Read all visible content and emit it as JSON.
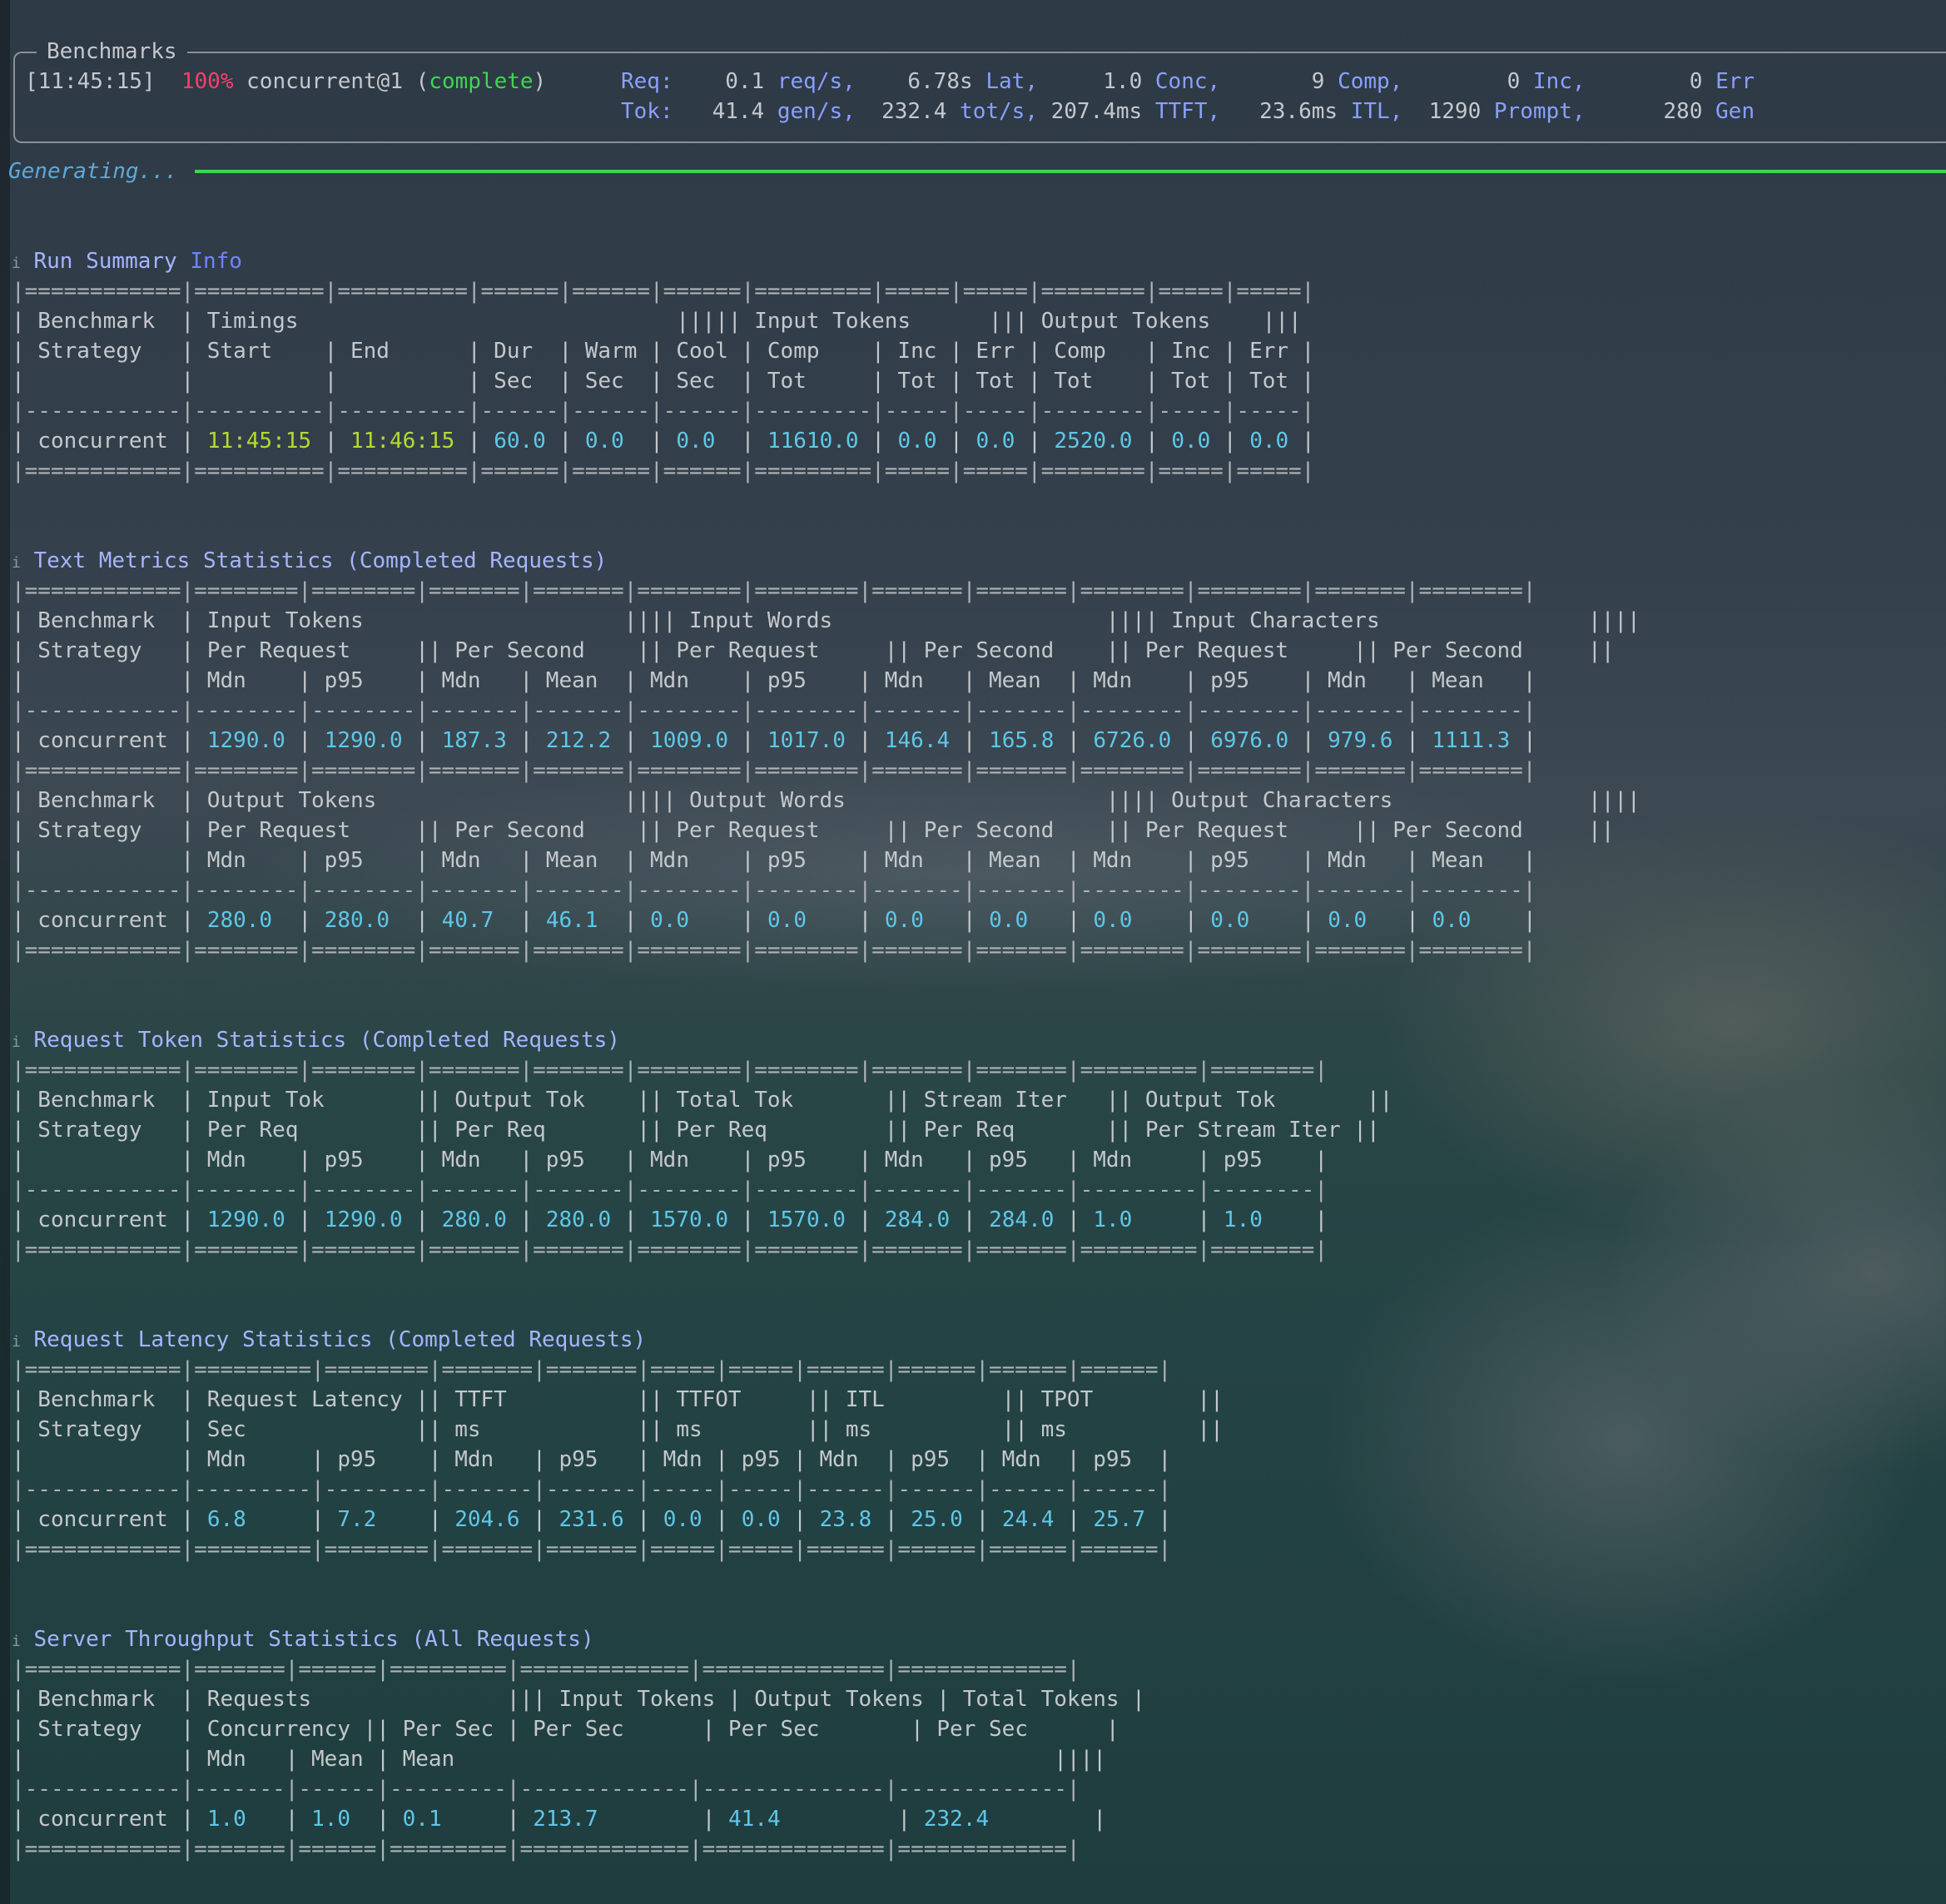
{
  "header": {
    "box_title": "Benchmarks",
    "time": "[11:45:15]",
    "percent": "100%",
    "strategy": "concurrent@1",
    "status": "complete",
    "req_label": "Req:",
    "req_rate": "0.1",
    "req_rate_unit": "req/s,",
    "lat": "6.78s",
    "lat_unit": "Lat,",
    "conc": "1.0",
    "conc_unit": "Conc,",
    "comp": "9",
    "comp_unit": "Comp,",
    "inc": "0",
    "inc_unit": "Inc,",
    "err": "0",
    "err_unit": "Err",
    "tok_label": "Tok:",
    "gen_rate": "41.4",
    "gen_rate_unit": "gen/s,",
    "tot_rate": "232.4",
    "tot_rate_unit": "tot/s,",
    "ttft": "207.4ms",
    "ttft_unit": "TTFT,",
    "itl": "23.6ms",
    "itl_unit": "ITL,",
    "prompt": "1290",
    "prompt_unit": "Prompt,",
    "gen": "280",
    "gen_unit": "Gen"
  },
  "progress": {
    "label": "Generating...",
    "fraction": 1.0,
    "color": "#3fd64f"
  },
  "section_icon": "info-icon",
  "run_summary": {
    "title": "Run Summary",
    "title_suffix": "Info",
    "sep": "|============|==========|==========|======|======|======|=========|=====|=====|========|=====|=====|",
    "h1": "| Benchmark  | Timings                             ||||| Input Tokens      ||| Output Tokens    |||",
    "h2": "| Strategy   | Start    | End      | Dur  | Warm | Cool | Comp    | Inc | Err | Comp   | Inc | Err |",
    "h3": "|            |          |          | Sec  | Sec  | Sec  | Tot     | Tot | Tot | Tot    | Tot | Tot |",
    "dash": "|------------|----------|----------|------|------|------|---------|-----|-----|--------|-----|-----|",
    "row": {
      "c0": "| concurrent | ",
      "start": "11:45:15",
      "s1": " | ",
      "end": "11:46:15",
      "s2": " | ",
      "dur": "60.0",
      "s3": " | ",
      "warm": "0.0",
      "s4": "  | ",
      "cool": "0.0",
      "s5": "  | ",
      "in_comp": "11610.0",
      "s6": " | ",
      "in_inc": "0.0",
      "s7": " | ",
      "in_err": "0.0",
      "s8": " | ",
      "out_comp": "2520.0",
      "s9": " | ",
      "out_inc": "0.0",
      "s10": " | ",
      "out_err": "0.0",
      "s11": " |"
    }
  },
  "text_metrics": {
    "title": "Text Metrics Statistics (Completed Requests)",
    "sep": "|============|========|========|=======|=======|========|========|=======|=======|========|========|=======|========|",
    "dash": "|------------|--------|--------|-------|-------|--------|--------|-------|-------|--------|--------|-------|--------|",
    "in_h1": "| Benchmark  | Input Tokens                    |||| Input Words                     |||| Input Characters                ||||",
    "in_h2": "| Strategy   | Per Request     || Per Second    || Per Request     || Per Second    || Per Request     || Per Second     ||",
    "in_h3": "|            | Mdn    | p95    | Mdn   | Mean  | Mdn    | p95    | Mdn   | Mean  | Mdn    | p95    | Mdn   | Mean   |",
    "in_row": {
      "c0": "| concurrent | ",
      "v1": "1290.0",
      "s1": " | ",
      "v2": "1290.0",
      "s2": " | ",
      "v3": "187.3",
      "s3": " | ",
      "v4": "212.2",
      "s4": " | ",
      "v5": "1009.0",
      "s5": " | ",
      "v6": "1017.0",
      "s6": " | ",
      "v7": "146.4",
      "s7": " | ",
      "v8": "165.8",
      "s8": " | ",
      "v9": "6726.0",
      "s9": " | ",
      "v10": "6976.0",
      "s10": " | ",
      "v11": "979.6",
      "s11": " | ",
      "v12": "1111.3",
      "s12": " |"
    },
    "out_h1": "| Benchmark  | Output Tokens                   |||| Output Words                    |||| Output Characters               ||||",
    "out_h2": "| Strategy   | Per Request     || Per Second    || Per Request     || Per Second    || Per Request     || Per Second     ||",
    "out_h3": "|            | Mdn    | p95    | Mdn   | Mean  | Mdn    | p95    | Mdn   | Mean  | Mdn    | p95    | Mdn   | Mean   |",
    "out_row": {
      "c0": "| concurrent | ",
      "v1": "280.0",
      "s1": "  | ",
      "v2": "280.0",
      "s2": "  | ",
      "v3": "40.7",
      "s3": "  | ",
      "v4": "46.1",
      "s4": "  | ",
      "v5": "0.0",
      "s5": "    | ",
      "v6": "0.0",
      "s6": "    | ",
      "v7": "0.0",
      "s7": "   | ",
      "v8": "0.0",
      "s8": "   | ",
      "v9": "0.0",
      "s9": "    | ",
      "v10": "0.0",
      "s10": "    | ",
      "v11": "0.0",
      "s11": "   | ",
      "v12": "0.0",
      "s12": "    |"
    }
  },
  "request_token": {
    "title": "Request Token Statistics (Completed Requests)",
    "sep": "|============|========|========|=======|=======|========|========|=======|=======|=========|========|",
    "h1": "| Benchmark  | Input Tok       || Output Tok    || Total Tok       || Stream Iter   || Output Tok       ||",
    "h2": "| Strategy   | Per Req         || Per Req       || Per Req         || Per Req       || Per Stream Iter ||",
    "h3": "|            | Mdn    | p95    | Mdn   | p95   | Mdn    | p95    | Mdn   | p95   | Mdn     | p95    |",
    "dash": "|------------|--------|--------|-------|-------|--------|--------|-------|-------|---------|--------|",
    "row": {
      "c0": "| concurrent | ",
      "v1": "1290.0",
      "s1": " | ",
      "v2": "1290.0",
      "s2": " | ",
      "v3": "280.0",
      "s3": " | ",
      "v4": "280.0",
      "s4": " | ",
      "v5": "1570.0",
      "s5": " | ",
      "v6": "1570.0",
      "s6": " | ",
      "v7": "284.0",
      "s7": " | ",
      "v8": "284.0",
      "s8": " | ",
      "v9": "1.0",
      "s9": "     | ",
      "v10": "1.0",
      "s10": "    |"
    }
  },
  "request_latency": {
    "title": "Request Latency Statistics (Completed Requests)",
    "sep": "|============|=========|========|=======|=======|=====|=====|======|======|======|======|",
    "h1": "| Benchmark  | Request Latency || TTFT          || TTFOT     || ITL         || TPOT        ||",
    "h2": "| Strategy   | Sec             || ms            || ms        || ms          || ms          ||",
    "h3": "|            | Mdn     | p95    | Mdn   | p95   | Mdn | p95 | Mdn  | p95  | Mdn  | p95  |",
    "dash": "|------------|---------|--------|-------|-------|-----|-----|------|------|------|------|",
    "row": {
      "c0": "| concurrent | ",
      "v1": "6.8",
      "s1": "     | ",
      "v2": "7.2",
      "s2": "    | ",
      "v3": "204.6",
      "s3": " | ",
      "v4": "231.6",
      "s4": " | ",
      "v5": "0.0",
      "s5": " | ",
      "v6": "0.0",
      "s6": " | ",
      "v7": "23.8",
      "s7": " | ",
      "v8": "25.0",
      "s8": " | ",
      "v9": "24.4",
      "s9": " | ",
      "v10": "25.7",
      "s10": " |"
    }
  },
  "server_throughput": {
    "title": "Server Throughput Statistics (All Requests)",
    "sep": "|============|=======|======|=========|=============|==============|=============|",
    "h1": "| Benchmark  | Requests               ||| Input Tokens | Output Tokens | Total Tokens |",
    "h2": "| Strategy   | Concurrency || Per Sec | Per Sec      | Per Sec       | Per Sec      |",
    "h3": "|            | Mdn   | Mean | Mean                                              ||||",
    "dash": "|------------|-------|------|---------|-------------|--------------|-------------|",
    "row": {
      "c0": "| concurrent | ",
      "v1": "1.0",
      "s1": "   | ",
      "v2": "1.0",
      "s2": "  | ",
      "v3": "0.1",
      "s3": "     | ",
      "v4": "213.7",
      "s4": "        | ",
      "v5": "41.4",
      "s5": "         | ",
      "v6": "232.4",
      "s6": "        |"
    }
  }
}
